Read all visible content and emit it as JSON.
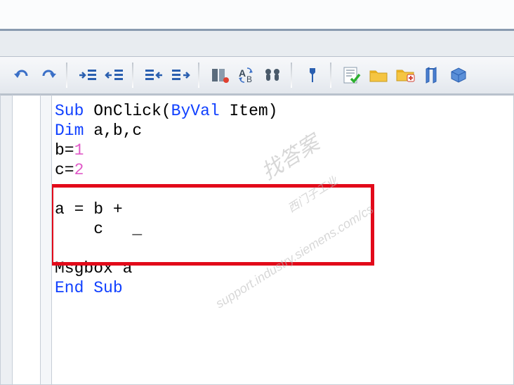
{
  "toolbar": {
    "undo": "undo",
    "redo": "redo",
    "indent": "indent",
    "outdent": "outdent",
    "rightIndent": "right-indent",
    "rightOutdent": "right-outdent",
    "toggleBreakpoint": "toggle-breakpoint",
    "find": "find-replace",
    "findNext": "find-next",
    "wrench": "settings",
    "validate": "validate",
    "folder": "folder",
    "newFolder": "new-folder",
    "measure": "measure",
    "cube": "object"
  },
  "code": {
    "l1a": "Sub",
    "l1b": " OnClick(",
    "l1c": "ByVal",
    "l1d": " Item)",
    "l2a": "Dim",
    "l2b": " a,b,c",
    "l3a": "b=",
    "l3b": "1",
    "l4a": "c=",
    "l4b": "2",
    "l5": "",
    "l6": "a = b +",
    "l7": "    c   _",
    "l8": "",
    "l9": "Msgbox a",
    "l10a": "End",
    "l10b": " ",
    "l10c": "Sub"
  },
  "watermark": {
    "w1": "support.industry.siemens.com/cs",
    "w2": "找答案",
    "w3": "西门子工业"
  }
}
